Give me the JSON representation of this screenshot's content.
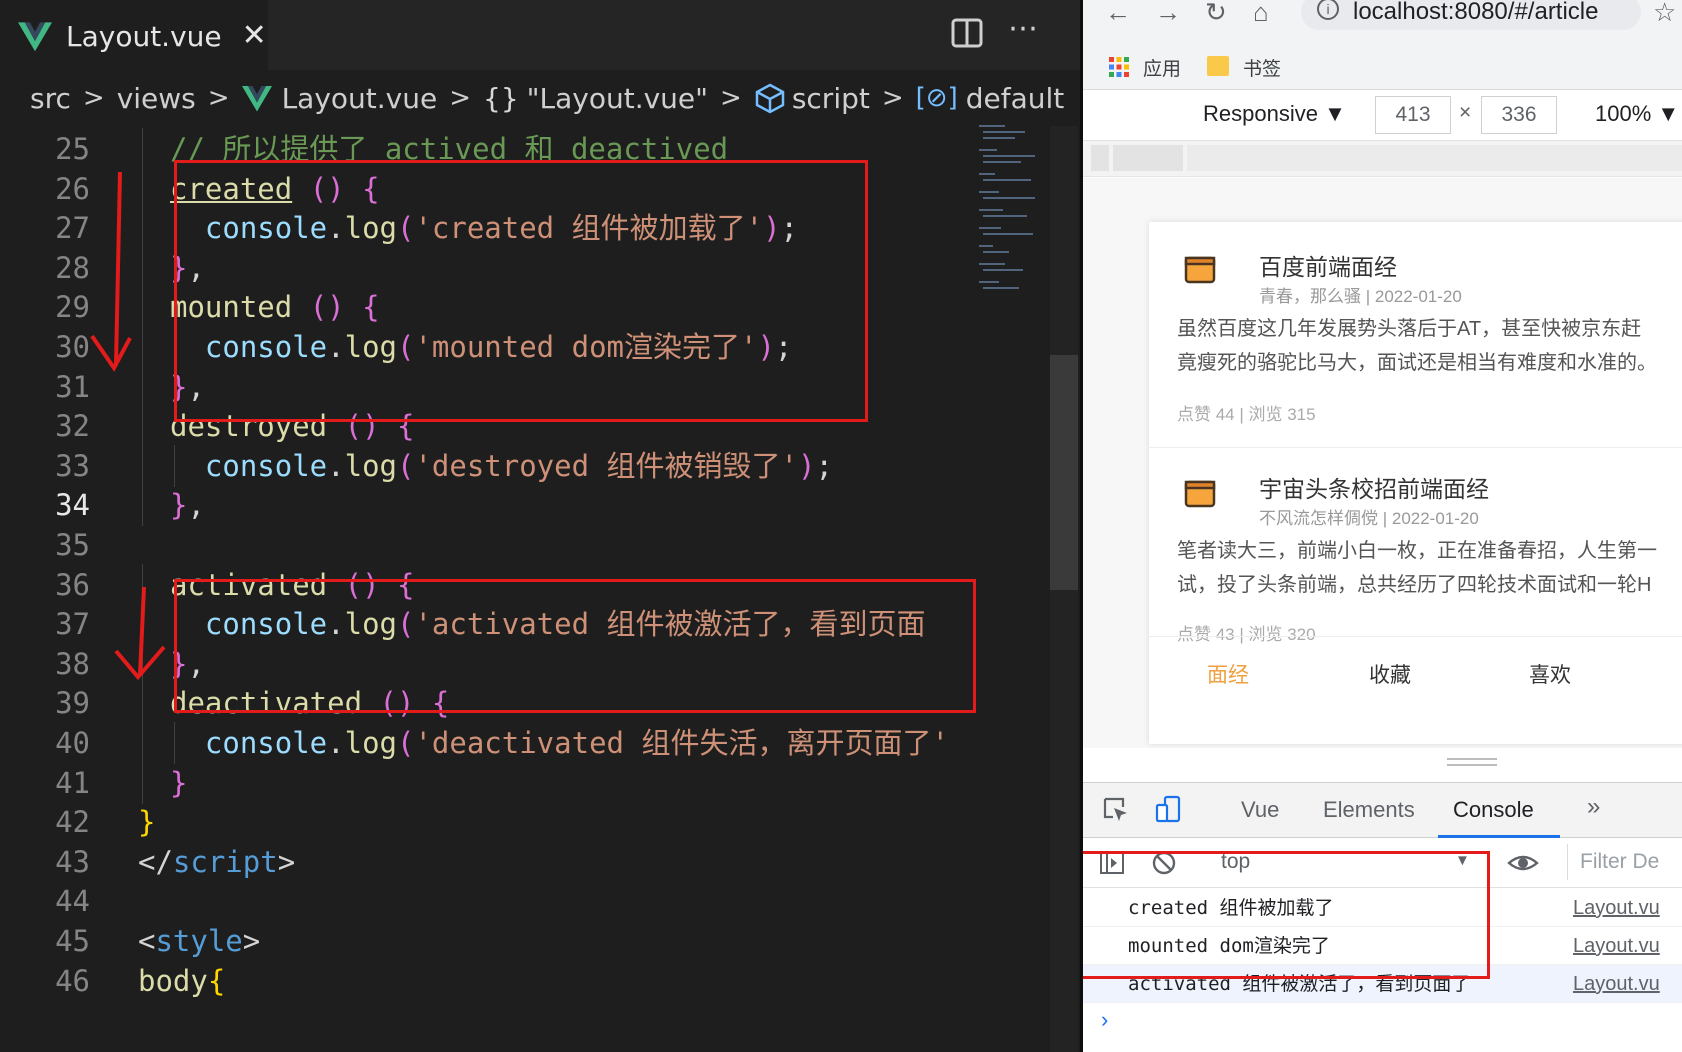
{
  "editor": {
    "tab": {
      "label": "Layout.vue",
      "close": "✕"
    },
    "more": "⋯",
    "breadcrumb": {
      "src": "src",
      "views": "views",
      "file": "Layout.vue",
      "component": "\"Layout.vue\"",
      "component_brace": "{}",
      "script": "script",
      "default": "default",
      "default_sym": "[⊘]"
    },
    "lines": [
      {
        "n": "25",
        "parts": [
          [
            "k-comment",
            "// 所以提供了 actived 和 deactived"
          ]
        ]
      },
      {
        "n": "26",
        "parts": [
          [
            "k-fn",
            "created"
          ],
          [
            "k-plain",
            " "
          ],
          [
            "k-paren",
            "()"
          ],
          [
            "k-plain",
            " "
          ],
          [
            "k-brace2",
            "{"
          ]
        ]
      },
      {
        "n": "27",
        "parts": [
          [
            "k-plain",
            "  "
          ],
          [
            "k-obj",
            "console"
          ],
          [
            "k-plain",
            "."
          ],
          [
            "k-fn",
            "log"
          ],
          [
            "k-paren",
            "("
          ],
          [
            "k-str",
            "'created 组件被加载了'"
          ],
          [
            "k-paren",
            ")"
          ],
          [
            "k-plain",
            ";"
          ]
        ]
      },
      {
        "n": "28",
        "parts": [
          [
            "k-brace2",
            "}"
          ],
          [
            "k-plain",
            ","
          ]
        ]
      },
      {
        "n": "29",
        "parts": [
          [
            "k-fn",
            "mounted"
          ],
          [
            "k-plain",
            " "
          ],
          [
            "k-paren",
            "()"
          ],
          [
            "k-plain",
            " "
          ],
          [
            "k-brace2",
            "{"
          ]
        ]
      },
      {
        "n": "30",
        "parts": [
          [
            "k-plain",
            "  "
          ],
          [
            "k-obj",
            "console"
          ],
          [
            "k-plain",
            "."
          ],
          [
            "k-fn",
            "log"
          ],
          [
            "k-paren",
            "("
          ],
          [
            "k-str",
            "'mounted dom渲染完了'"
          ],
          [
            "k-paren",
            ")"
          ],
          [
            "k-plain",
            ";"
          ]
        ]
      },
      {
        "n": "31",
        "parts": [
          [
            "k-brace2",
            "}"
          ],
          [
            "k-plain",
            ","
          ]
        ]
      },
      {
        "n": "32",
        "parts": [
          [
            "k-fn",
            "destroyed"
          ],
          [
            "k-plain",
            " "
          ],
          [
            "k-paren",
            "()"
          ],
          [
            "k-plain",
            " "
          ],
          [
            "k-brace2",
            "{"
          ]
        ]
      },
      {
        "n": "33",
        "parts": [
          [
            "k-plain",
            "  "
          ],
          [
            "k-obj",
            "console"
          ],
          [
            "k-plain",
            "."
          ],
          [
            "k-fn",
            "log"
          ],
          [
            "k-paren",
            "("
          ],
          [
            "k-str",
            "'destroyed 组件被销毁了'"
          ],
          [
            "k-paren",
            ")"
          ],
          [
            "k-plain",
            ";"
          ]
        ]
      },
      {
        "n": "34",
        "parts": [
          [
            "k-brace2",
            "}"
          ],
          [
            "k-plain",
            ","
          ]
        ]
      },
      {
        "n": "35",
        "parts": []
      },
      {
        "n": "36",
        "parts": [
          [
            "k-fn",
            "activated"
          ],
          [
            "k-plain",
            " "
          ],
          [
            "k-paren",
            "()"
          ],
          [
            "k-plain",
            " "
          ],
          [
            "k-brace2",
            "{"
          ]
        ]
      },
      {
        "n": "37",
        "parts": [
          [
            "k-plain",
            "  "
          ],
          [
            "k-obj",
            "console"
          ],
          [
            "k-plain",
            "."
          ],
          [
            "k-fn",
            "log"
          ],
          [
            "k-paren",
            "("
          ],
          [
            "k-str",
            "'activated 组件被激活了，看到页面"
          ]
        ]
      },
      {
        "n": "38",
        "parts": [
          [
            "k-brace2",
            "}"
          ],
          [
            "k-plain",
            ","
          ]
        ]
      },
      {
        "n": "39",
        "parts": [
          [
            "k-fn",
            "deactivated"
          ],
          [
            "k-plain",
            " "
          ],
          [
            "k-paren",
            "()"
          ],
          [
            "k-plain",
            " "
          ],
          [
            "k-brace2",
            "{"
          ]
        ]
      },
      {
        "n": "40",
        "parts": [
          [
            "k-plain",
            "  "
          ],
          [
            "k-obj",
            "console"
          ],
          [
            "k-plain",
            "."
          ],
          [
            "k-fn",
            "log"
          ],
          [
            "k-paren",
            "("
          ],
          [
            "k-str",
            "'deactivated 组件失活，离开页面了'"
          ]
        ]
      },
      {
        "n": "41",
        "parts": [
          [
            "k-brace2",
            "}"
          ]
        ]
      },
      {
        "n": "42",
        "indent": "outer",
        "parts": [
          [
            "k-brace",
            "}"
          ]
        ]
      },
      {
        "n": "43",
        "indent": "outer",
        "parts": [
          [
            "k-punc",
            "</"
          ],
          [
            "k-tagname",
            "script"
          ],
          [
            "k-punc",
            ">"
          ]
        ]
      },
      {
        "n": "44",
        "parts": []
      },
      {
        "n": "45",
        "indent": "outer",
        "parts": [
          [
            "k-punc",
            "<"
          ],
          [
            "k-tagname",
            "style"
          ],
          [
            "k-punc",
            ">"
          ]
        ]
      },
      {
        "n": "46",
        "indent": "outer",
        "parts": [
          [
            "k-fn",
            "body"
          ],
          [
            "k-brace",
            "{"
          ]
        ]
      }
    ],
    "active_line": "34"
  },
  "browser": {
    "url": "localhost:8080/#/article",
    "bookmarks": {
      "apps": "应用",
      "folder": "书签"
    },
    "device": {
      "mode": "Responsive ▼",
      "width": "413",
      "times": "×",
      "height": "336",
      "zoom": "100% ▼"
    },
    "articles": [
      {
        "title": "百度前端面经",
        "meta": "青春，那么骚 | 2022-01-20",
        "body1": "虽然百度这几年发展势头落后于AT，甚至快被京东赶",
        "body2": "竟瘦死的骆驼比马大，面试还是相当有难度和水准的。",
        "stats": "点赞 44 | 浏览 315"
      },
      {
        "title": "宇宙头条校招前端面经",
        "meta": "不风流怎样倜傥 | 2022-01-20",
        "body1": "笔者读大三，前端小白一枚，正在准备春招，人生第一",
        "body2": "试，投了头条前端，总共经历了四轮技术面试和一轮H",
        "stats": "点赞 43 | 浏览 320"
      }
    ],
    "app_tabs": [
      "面经",
      "收藏",
      "喜欢"
    ],
    "active_app_tab_color": "#f0a040"
  },
  "devtools": {
    "tabs": {
      "vue": "Vue",
      "elements": "Elements",
      "console": "Console",
      "more": "»"
    },
    "context": "top",
    "filter": "Filter   De",
    "messages": [
      {
        "text": "created 组件被加载了",
        "src": "Layout.vu"
      },
      {
        "text": "mounted dom渲染完了",
        "src": "Layout.vu"
      },
      {
        "text": "activated 组件被激活了，看到页面了",
        "src": "Layout.vu"
      }
    ],
    "prompt": "›"
  },
  "colors": {
    "annotation_red": "#e31b1b",
    "editor_bg": "#1e1e1e",
    "console_blue": "#1a73e8"
  }
}
